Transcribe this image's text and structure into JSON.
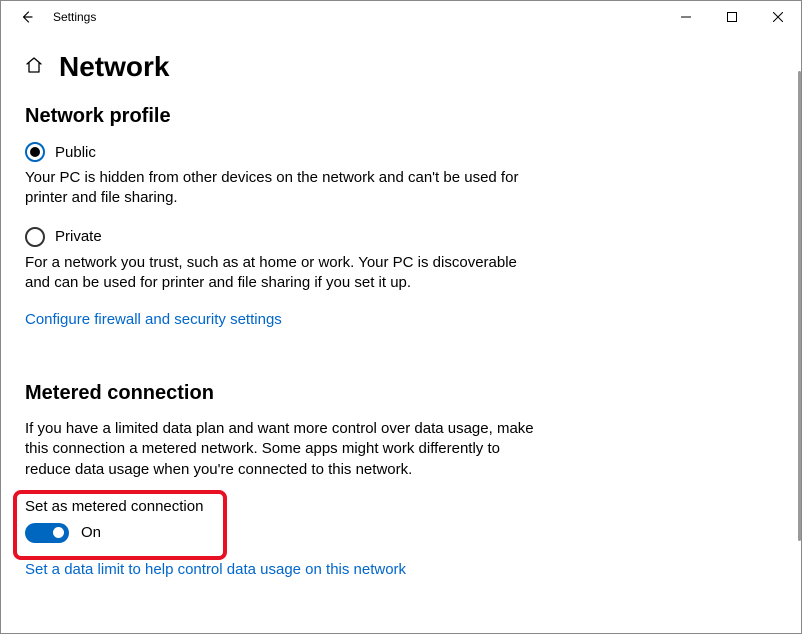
{
  "titlebar": {
    "app_title": "Settings"
  },
  "header": {
    "title": "Network"
  },
  "network_profile": {
    "heading": "Network profile",
    "public_label": "Public",
    "public_desc": "Your PC is hidden from other devices on the network and can't be used for printer and file sharing.",
    "private_label": "Private",
    "private_desc": "For a network you trust, such as at home or work. Your PC is discoverable and can be used for printer and file sharing if you set it up.",
    "firewall_link": "Configure firewall and security settings"
  },
  "metered": {
    "heading": "Metered connection",
    "desc": "If you have a limited data plan and want more control over data usage, make this connection a metered network. Some apps might work differently to reduce data usage when you're connected to this network.",
    "toggle_label": "Set as metered connection",
    "toggle_state": "On",
    "data_limit_link": "Set a data limit to help control data usage on this network"
  }
}
